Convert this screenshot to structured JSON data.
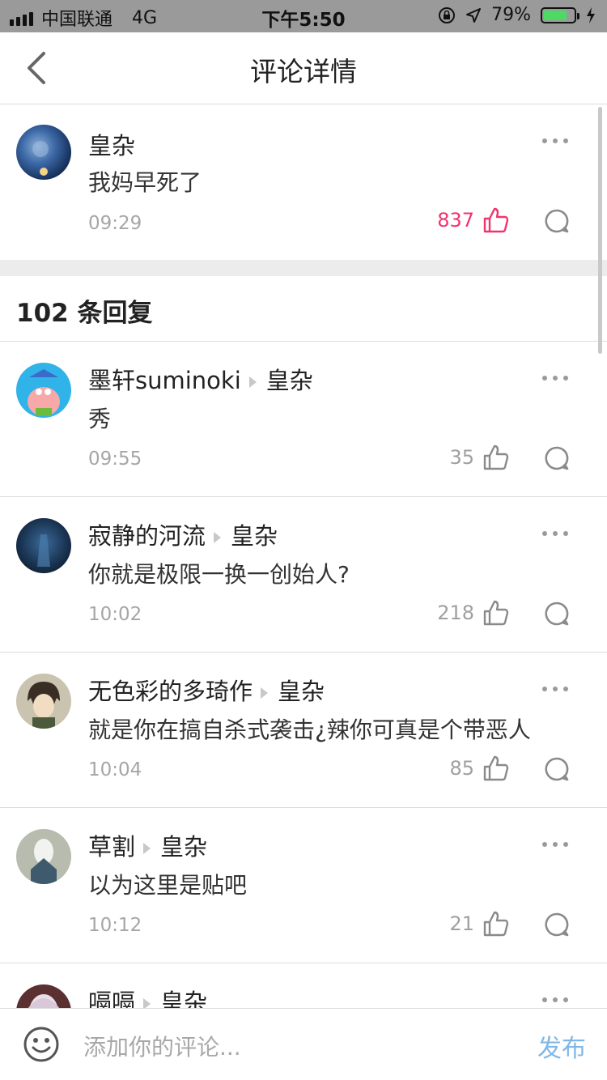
{
  "status": {
    "carrier": "中国联通",
    "network": "4G",
    "time": "下午5:50",
    "battery": "79%",
    "battery_level": 0.79
  },
  "nav": {
    "title": "评论详情"
  },
  "main_comment": {
    "user": "皇杂",
    "text": "我妈早死了",
    "time": "09:29",
    "likes": "837"
  },
  "replies_header": "102 条回复",
  "replies": [
    {
      "user": "墨轩suminoki",
      "target": "皇杂",
      "text": "秀",
      "time": "09:55",
      "likes": "35"
    },
    {
      "user": "寂静的河流",
      "target": "皇杂",
      "text": "你就是极限一换一创始人?",
      "time": "10:02",
      "likes": "218"
    },
    {
      "user": "无色彩的多琦作",
      "target": "皇杂",
      "text": "就是你在搞自杀式袭击¿辣你可真是个带恶人",
      "time": "10:04",
      "likes": "85"
    },
    {
      "user": "草割",
      "target": "皇杂",
      "text": "以为这里是贴吧",
      "time": "10:12",
      "likes": "21"
    },
    {
      "user": "嗝嗝",
      "target": "皇杂",
      "text": "",
      "time": "",
      "likes": ""
    }
  ],
  "bottom": {
    "placeholder": "添加你的评论...",
    "publish": "发布"
  },
  "colors": {
    "like_active": "#f0346f",
    "publish": "#7fb8e8",
    "battery": "#4cd964"
  }
}
